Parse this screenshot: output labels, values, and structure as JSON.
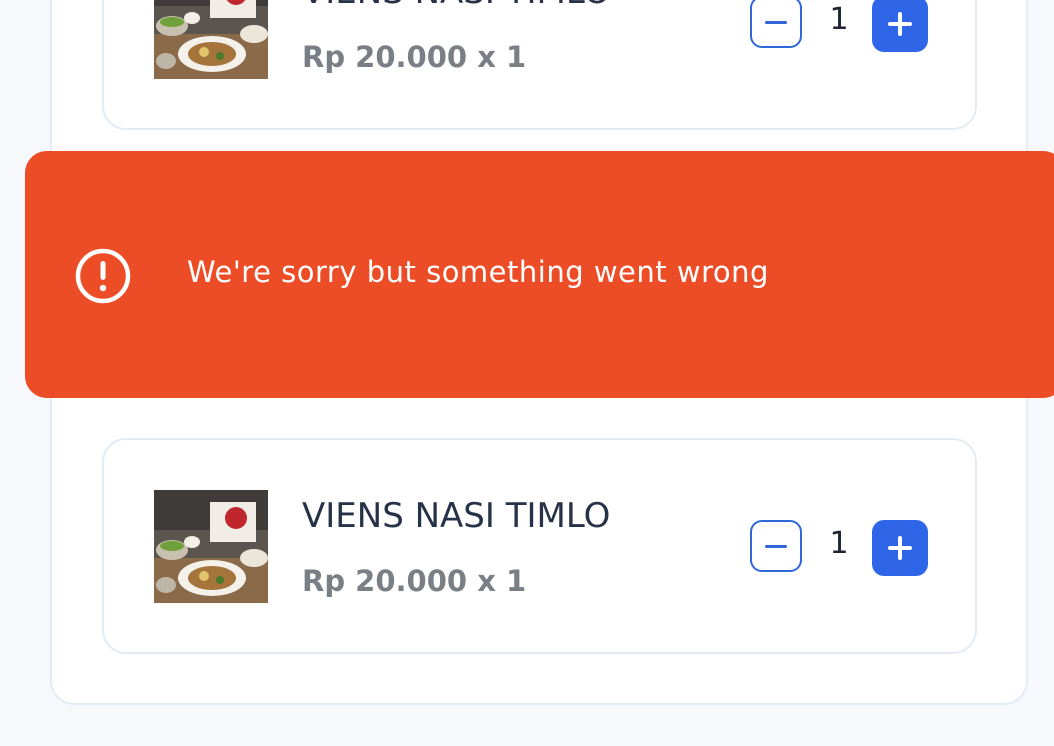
{
  "cart": {
    "items": [
      {
        "name": "VIENS NASI TIMLO",
        "price_line": "Rp 20.000 x 1",
        "quantity": "1"
      },
      {
        "name": "VIENS NASI TIMLO",
        "price_line": "Rp 20.000 x 1",
        "quantity": "1"
      }
    ]
  },
  "toast": {
    "message": "We're sorry but something went wrong",
    "icon": "alert-circle-icon",
    "background": "#ec4d27"
  },
  "icons": {
    "decrement": "minus-icon",
    "increment": "plus-icon"
  },
  "colors": {
    "accent": "#2f66e8",
    "card_border": "#e3ebf5",
    "text_dark": "#263247",
    "text_muted": "#7a7f86"
  }
}
